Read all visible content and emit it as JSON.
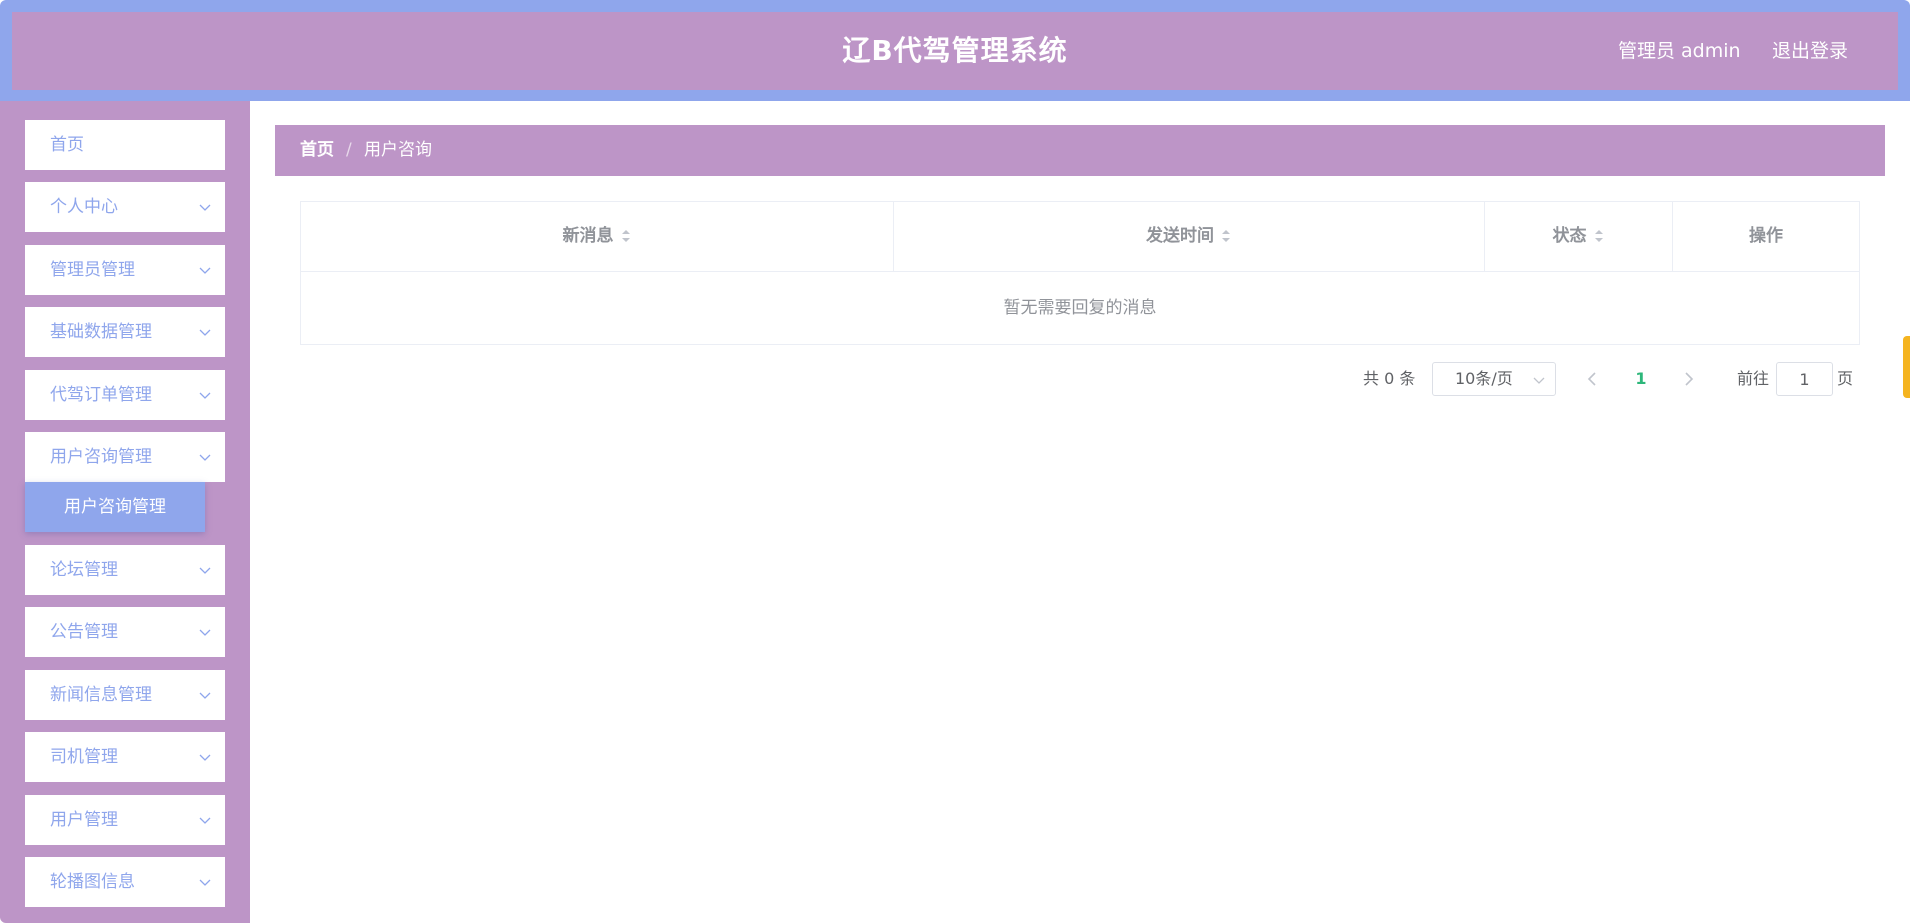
{
  "header": {
    "title": "辽B代驾管理系统",
    "user_label": "管理员 admin",
    "logout_label": "退出登录"
  },
  "sidebar": {
    "home": "首页",
    "items": [
      {
        "label": "个人中心"
      },
      {
        "label": "管理员管理"
      },
      {
        "label": "基础数据管理"
      },
      {
        "label": "代驾订单管理"
      },
      {
        "label": "用户咨询管理"
      },
      {
        "label": "论坛管理"
      },
      {
        "label": "公告管理"
      },
      {
        "label": "新闻信息管理"
      },
      {
        "label": "司机管理"
      },
      {
        "label": "用户管理"
      },
      {
        "label": "轮播图信息"
      }
    ],
    "active_submenu": "用户咨询管理"
  },
  "breadcrumb": {
    "home": "首页",
    "separator": "/",
    "current": "用户咨询"
  },
  "table": {
    "columns": [
      "新消息",
      "发送时间",
      "状态",
      "操作"
    ],
    "empty_text": "暂无需要回复的消息"
  },
  "pagination": {
    "total_label": "共 0 条",
    "page_size": "10条/页",
    "current_page": "1",
    "goto_label": "前往",
    "goto_value": "1",
    "page_suffix": "页"
  },
  "colors": {
    "header_outer": "#8fa6ec",
    "theme_purple": "#bd95c7",
    "menu_text": "#8fa6ec",
    "current_page": "#2db77a"
  }
}
